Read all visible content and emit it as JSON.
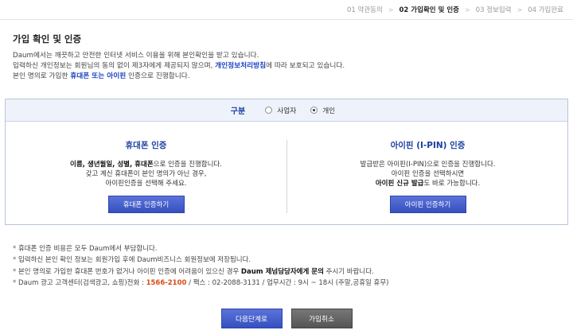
{
  "steps": [
    {
      "label": "01 약관동의",
      "active": false
    },
    {
      "label": "02 가입확인 및 인증",
      "active": true
    },
    {
      "label": "03 정보입력",
      "active": false
    },
    {
      "label": "04 가입완료",
      "active": false
    }
  ],
  "step_separator": ">",
  "page_title": "가입 확인 및 인증",
  "intro": {
    "line1": "Daum에서는 깨끗하고 안전한 인터넷 서비스 이용을 위해 본인확인을 받고 있습니다.",
    "line2_pre": "입력하신 개인정보는 회원님의 동의 없이 제3자에게 제공되지 않으며, ",
    "line2_link": "개인정보처리방침",
    "line2_post": "에 따라 보호되고 있습니다.",
    "line3_pre": "본인 명의로 가입한 ",
    "line3_hl": "휴대폰 또는 아이핀",
    "line3_post": " 인증으로 진행합니다."
  },
  "type_selector": {
    "label": "구분",
    "options": [
      {
        "label": "사업자",
        "selected": false
      },
      {
        "label": "개인",
        "selected": true
      }
    ]
  },
  "phone_auth": {
    "title": "휴대폰 인증",
    "desc1_bold": "이름, 생년월일, 성별, 휴대폰",
    "desc1_rest": "으로 인증을 진행합니다.",
    "desc2": "갖고 계신 휴대폰이 본인 명의가 아닌 경우,",
    "desc3": "아이핀인증을 선택해 주세요.",
    "button": "휴대폰 인증하기"
  },
  "ipin_auth": {
    "title": "아이핀 (I-PIN) 인증",
    "desc1": "발급받은 아이핀(I-PIN)으로 인증을 진행합니다.",
    "desc2": "아이핀 인증을 선택하시면",
    "desc3_bold": "아이핀 신규 발급",
    "desc3_rest": "도 바로 가능합니다.",
    "button": "아이핀 인증하기"
  },
  "notes": {
    "n1": "휴대폰 인증 비용은 모두 Daum에서 부담합니다.",
    "n2": "입력하신 본인 확인 정보는 회원가입 후에 Daum비즈니스 회원정보에 저장됩니다.",
    "n3_pre": "본인 명의로 가입한 휴대폰 번호가 없거나 아이핀 인증에 어려움이 있으신 경우 ",
    "n3_bold": "Daum 제넘담당자에게 문의",
    "n3_post": " 주시기 바랍니다.",
    "n4_pre": "Daum 광고 고객센터(검색광고, 쇼핑)전화 : ",
    "n4_phone": "1566-2100",
    "n4_post": " / 팩스 : 02-2088-3131 / 업무시간 : 9시 ~ 18시 (주말,공휴일 휴무)"
  },
  "footer": {
    "next": "다음단계로",
    "cancel": "가입취소"
  }
}
